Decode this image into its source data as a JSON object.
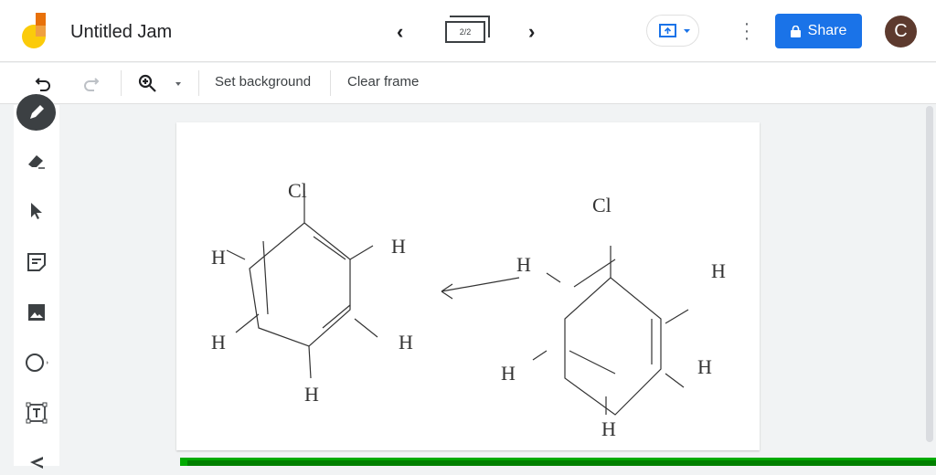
{
  "header": {
    "title": "Untitled Jam",
    "frame_indicator": "2/2",
    "share_label": "Share",
    "avatar_initial": "C"
  },
  "toolbar": {
    "set_background": "Set background",
    "clear_frame": "Clear frame"
  },
  "tools": [
    "pen-icon",
    "eraser-icon",
    "select-icon",
    "sticky-note-icon",
    "image-icon",
    "circle-icon",
    "text-box-icon",
    "laser-icon"
  ],
  "drawing": {
    "left_label_top": "Cl",
    "right_label_top": "Cl",
    "h": "H"
  },
  "colors": {
    "accent": "#1a73e8",
    "progress": "#008000"
  }
}
